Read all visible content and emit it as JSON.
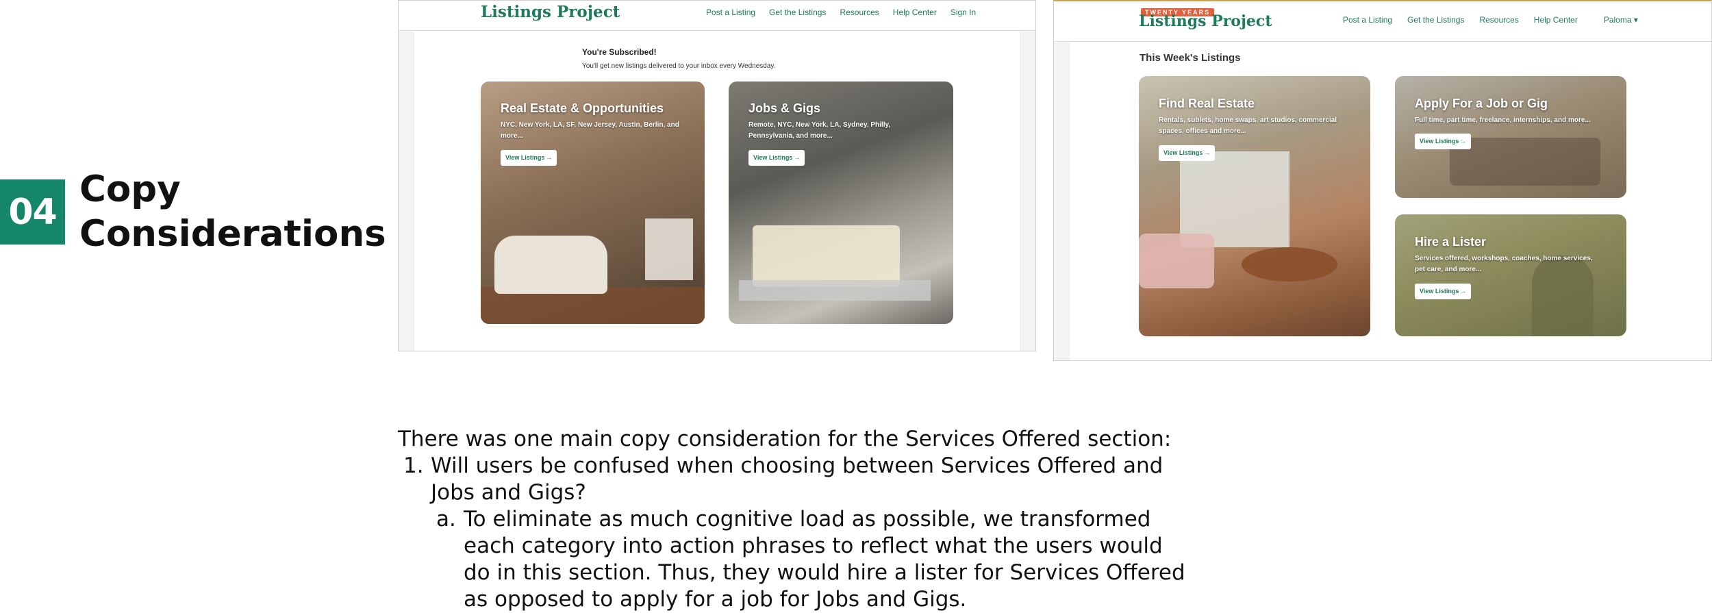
{
  "section": {
    "number": "04",
    "title": "Copy Considerations"
  },
  "shot1": {
    "logo": "Listings Project",
    "nav": [
      "Post a Listing",
      "Get the Listings",
      "Resources",
      "Help Center",
      "Sign In"
    ],
    "subscribed_title": "You're Subscribed!",
    "subscribed_text": "You'll get new listings delivered to your inbox every Wednesday.",
    "cards": [
      {
        "title": "Real Estate & Opportunities",
        "desc": "NYC, New York, LA, SF, New Jersey, Austin, Berlin, and more...",
        "button": "View Listings"
      },
      {
        "title": "Jobs & Gigs",
        "desc": "Remote, NYC, New York, LA, Sydney, Philly, Pennsylvania, and more...",
        "button": "View Listings"
      }
    ]
  },
  "shot2": {
    "logo_badge": "TWENTY YEARS",
    "logo": "Listings Project",
    "nav": [
      "Post a Listing",
      "Get the Listings",
      "Resources",
      "Help Center"
    ],
    "user": "Paloma",
    "section_title": "This Week's Listings",
    "cards": [
      {
        "title": "Find Real Estate",
        "desc": "Rentals, sublets, home swaps, art studios, commercial spaces, offices and more...",
        "button": "View Listings"
      },
      {
        "title": "Apply For a Job or Gig",
        "desc": "Full time, part time, freelance, internships, and more...",
        "button": "View Listings"
      },
      {
        "title": "Hire a Lister",
        "desc": "Services offered, workshops, coaches, home services, pet care, and more...",
        "button": "View Listings"
      }
    ]
  },
  "body": {
    "intro": "There was one main copy consideration for the Services Offered section:",
    "item1_marker": "1.",
    "item1": "Will users be confused when choosing between Services Offered and Jobs and Gigs?",
    "item1a_marker": "a.",
    "item1a": "To eliminate as much cognitive load as possible, we transformed each category into action phrases to reflect what the users would do in this section. Thus, they would hire a lister for Services Offered as opposed to apply for a job for Jobs and Gigs."
  },
  "colors": {
    "accent": "#16866b",
    "link": "#1e7a5d",
    "badge": "#e0613e"
  }
}
